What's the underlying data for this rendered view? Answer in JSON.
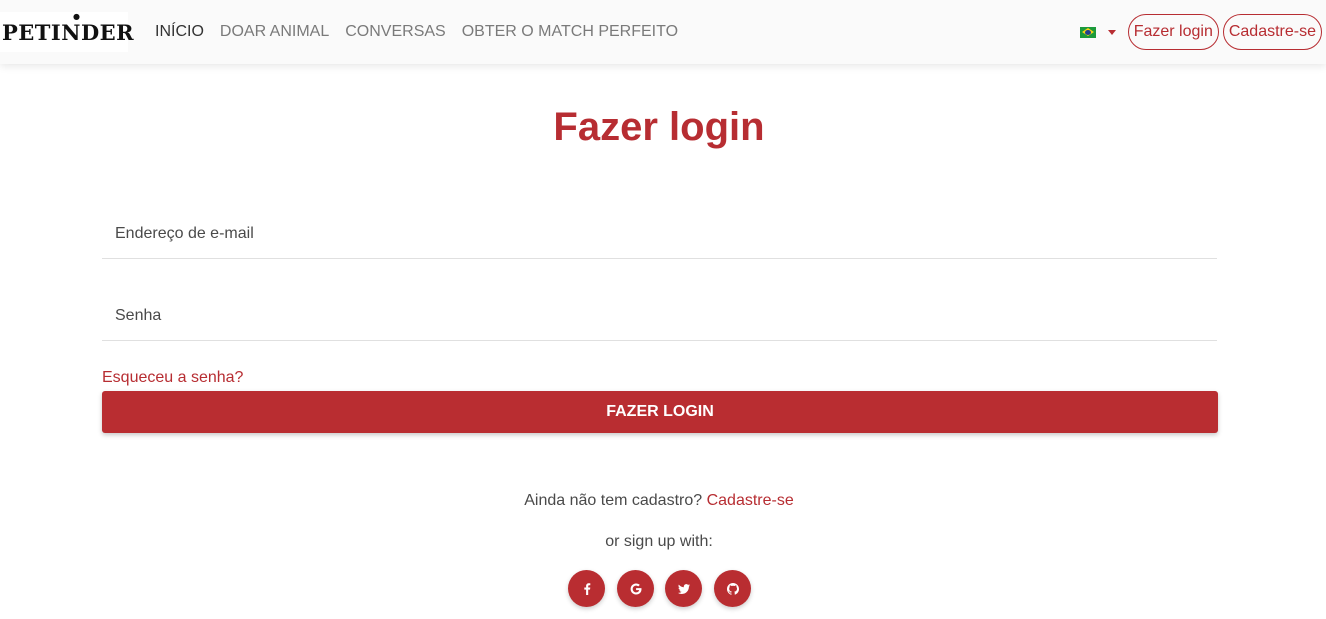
{
  "brand": {
    "name": "PETINDER"
  },
  "nav": {
    "items": [
      {
        "label": "INÍCIO",
        "active": true
      },
      {
        "label": "DOAR ANIMAL",
        "active": false
      },
      {
        "label": "CONVERSAS",
        "active": false
      },
      {
        "label": "OBTER O MATCH PERFEITO",
        "active": false
      }
    ],
    "language_flag": "brazil-flag-icon",
    "login_label": "Fazer login",
    "register_label": "Cadastre-se"
  },
  "colors": {
    "accent": "#b72d32",
    "navbar_bg": "#fafafa"
  },
  "login": {
    "title": "Fazer login",
    "email_placeholder": "Endereço de e-mail",
    "email_value": "",
    "password_placeholder": "Senha",
    "password_value": "",
    "forgot_label": "Esqueceu a senha?",
    "submit_label": "FAZER LOGIN",
    "register_prompt": "Ainda não tem cadastro?",
    "register_link": "Cadastre-se",
    "social_caption": "or sign up with:",
    "social": [
      "facebook-icon",
      "google-icon",
      "twitter-icon",
      "github-icon"
    ]
  }
}
